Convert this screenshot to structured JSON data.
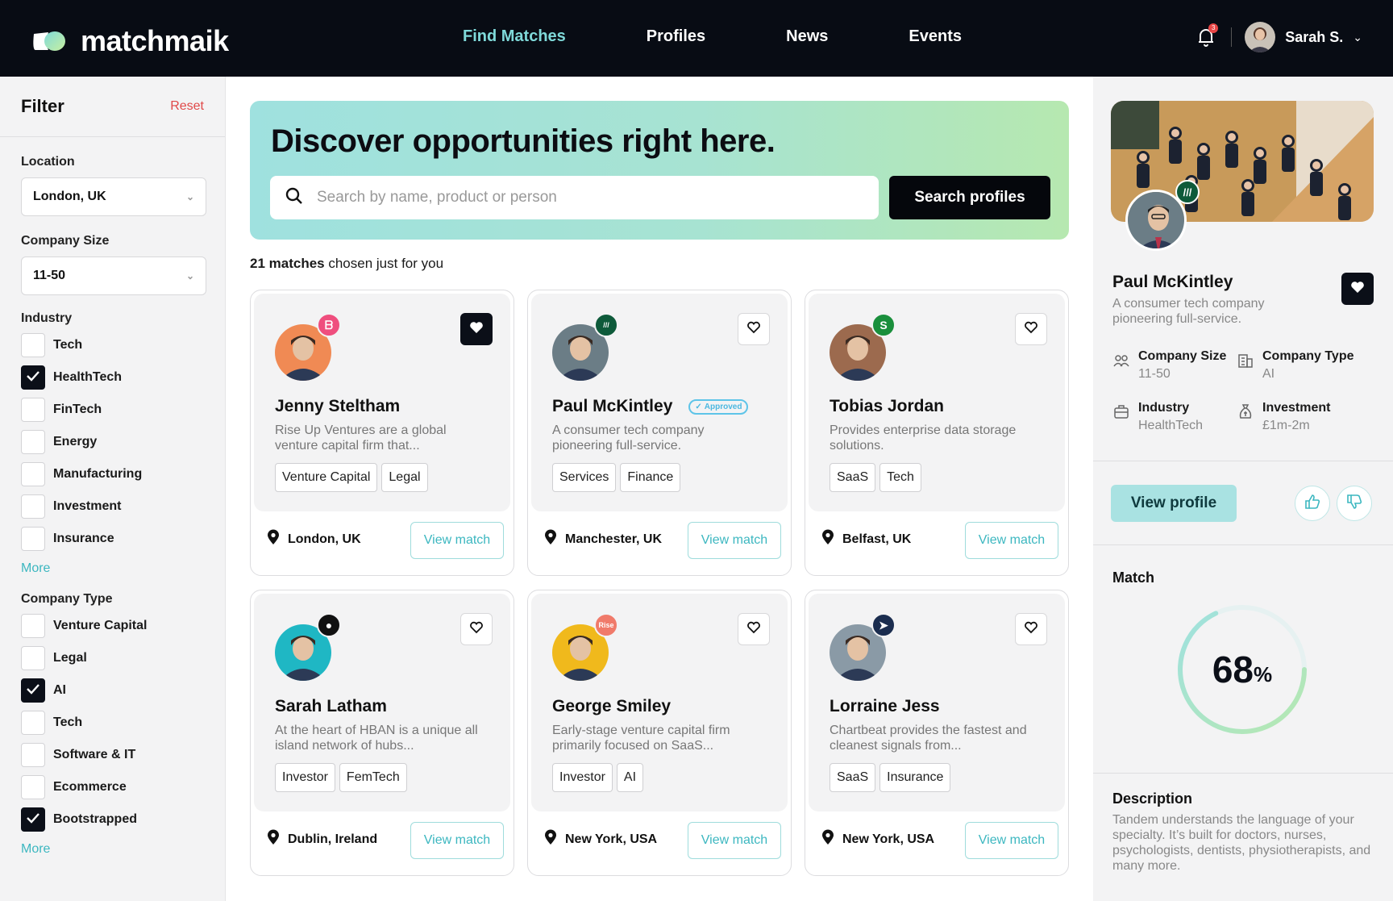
{
  "header": {
    "brand": "matchmaik",
    "nav": [
      {
        "label": "Find Matches",
        "active": true
      },
      {
        "label": "Profiles",
        "active": false
      },
      {
        "label": "News",
        "active": false
      },
      {
        "label": "Events",
        "active": false
      }
    ],
    "notification_count": "3",
    "user_name": "Sarah S."
  },
  "sidebar": {
    "title": "Filter",
    "reset_label": "Reset",
    "location_label": "Location",
    "location_value": "London, UK",
    "company_size_label": "Company Size",
    "company_size_value": "11-50",
    "industry_label": "Industry",
    "industries": [
      {
        "label": "Tech",
        "checked": false
      },
      {
        "label": "HealthTech",
        "checked": true
      },
      {
        "label": "FinTech",
        "checked": false
      },
      {
        "label": "Energy",
        "checked": false
      },
      {
        "label": "Manufacturing",
        "checked": false
      },
      {
        "label": "Investment",
        "checked": false
      },
      {
        "label": "Insurance",
        "checked": false
      }
    ],
    "more_label": "More",
    "company_type_label": "Company Type",
    "company_types": [
      {
        "label": "Venture Capital",
        "checked": false
      },
      {
        "label": "Legal",
        "checked": false
      },
      {
        "label": "AI",
        "checked": true
      },
      {
        "label": "Tech",
        "checked": false
      },
      {
        "label": "Software & IT",
        "checked": false
      },
      {
        "label": "Ecommerce",
        "checked": false
      },
      {
        "label": "Bootstrapped",
        "checked": true
      }
    ]
  },
  "main": {
    "hero_title": "Discover opportunities right here.",
    "search_placeholder": "Search by name, product or person",
    "search_button": "Search profiles",
    "matches_count_bold": "21 matches",
    "matches_count_rest": " chosen just for you",
    "cards": [
      {
        "name": "Jenny Steltham",
        "desc": "Rise Up Ventures are a global venture capital firm that...",
        "tags": [
          "Venture Capital",
          "Legal"
        ],
        "location": "London, UK",
        "favorited": true,
        "approved": false,
        "badge_color": "#ef4e7e",
        "badge_glyph": "ᗷ",
        "avatar_bg": "#f08a54"
      },
      {
        "name": "Paul McKintley",
        "approved_label": "Approved",
        "desc": "A consumer tech company pioneering full-service.",
        "tags": [
          "Services",
          "Finance"
        ],
        "location": "Manchester, UK",
        "favorited": false,
        "approved": true,
        "badge_color": "#0e5a3a",
        "badge_glyph": "///",
        "avatar_bg": "#6b7d86"
      },
      {
        "name": "Tobias Jordan",
        "desc": "Provides enterprise data storage solutions.",
        "tags": [
          "SaaS",
          "Tech"
        ],
        "location": "Belfast, UK",
        "favorited": false,
        "approved": false,
        "badge_color": "#1a8f3c",
        "badge_glyph": "S",
        "avatar_bg": "#9c6a4e"
      },
      {
        "name": "Sarah Latham",
        "desc": "At the heart of HBAN is a unique all island network of hubs...",
        "tags": [
          "Investor",
          "FemTech"
        ],
        "location": "Dublin, Ireland",
        "favorited": false,
        "approved": false,
        "badge_color": "#111111",
        "badge_glyph": "●",
        "avatar_bg": "#1fb7c4"
      },
      {
        "name": "George Smiley",
        "desc": "Early-stage venture capital firm primarily focused on SaaS...",
        "tags": [
          "Investor",
          "AI"
        ],
        "location": "New York, USA",
        "favorited": false,
        "approved": false,
        "badge_color": "#f07a6a",
        "badge_glyph": "Rise",
        "avatar_bg": "#f0b91c"
      },
      {
        "name": "Lorraine Jess",
        "desc": "Chartbeat provides the fastest and cleanest signals from...",
        "tags": [
          "SaaS",
          "Insurance"
        ],
        "location": "New York, USA",
        "favorited": false,
        "approved": false,
        "badge_color": "#1b2d4f",
        "badge_glyph": "➤",
        "avatar_bg": "#8a9aa6"
      }
    ],
    "view_match_label": "View match"
  },
  "profile": {
    "name": "Paul McKintley",
    "desc": "A consumer tech company pioneering full-service.",
    "facts": [
      {
        "label": "Company Size",
        "value": "11-50",
        "icon": "people-icon"
      },
      {
        "label": "Company Type",
        "value": "AI",
        "icon": "building-icon"
      },
      {
        "label": "Industry",
        "value": "HealthTech",
        "icon": "briefcase-icon"
      },
      {
        "label": "Investment",
        "value": "£1m-2m",
        "icon": "money-bag-icon"
      }
    ],
    "view_profile_label": "View profile",
    "match_label": "Match",
    "match_percent": 68,
    "match_value": "68",
    "match_unit": "%",
    "description_label": "Description",
    "description": "Tandem understands the language of your specialty. It’s built for doctors, nurses, psychologists, dentists, physiotherapists, and many more."
  },
  "colors": {
    "accent": "#3cb7c0",
    "dark": "#080c14",
    "reset": "#e04848",
    "gauge_start": "#9fe1df",
    "gauge_end": "#b6e8b0"
  }
}
